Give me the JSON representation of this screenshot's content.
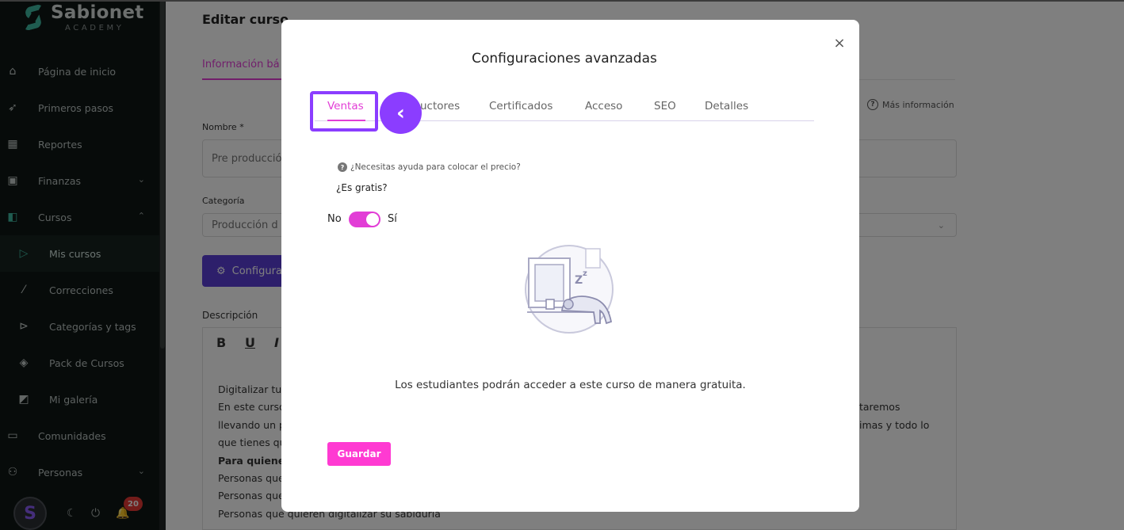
{
  "brand": {
    "name": "Sabionet",
    "sub": "ACADEMY"
  },
  "sidebar": {
    "items": [
      {
        "label": "Página de inicio",
        "icon": "home-icon"
      },
      {
        "label": "Primeros pasos",
        "icon": "rocket-icon"
      },
      {
        "label": "Reportes",
        "icon": "chart-icon"
      },
      {
        "label": "Finanzas",
        "icon": "wallet-icon"
      },
      {
        "label": "Cursos",
        "icon": "courses-icon"
      },
      {
        "label": "Mis cursos",
        "icon": "play-icon"
      },
      {
        "label": "Correcciones",
        "icon": "grade-icon"
      },
      {
        "label": "Categorías y tags",
        "icon": "tag-icon"
      },
      {
        "label": "Pack de Cursos",
        "icon": "layers-icon"
      },
      {
        "label": "Mi galería",
        "icon": "gallery-icon"
      },
      {
        "label": "Comunidades",
        "icon": "chat-icon"
      },
      {
        "label": "Personas",
        "icon": "people-icon"
      }
    ],
    "notifications": "20"
  },
  "page": {
    "title": "Editar curso",
    "tab": "Información bá",
    "more_info": "Más información",
    "name_label": "Nombre *",
    "name_value": "Pre producción",
    "category_label": "Categoría",
    "category_value": "Producción d",
    "config_button": "Configura",
    "description_label": "Descripción",
    "description_lines": [
      "Digitalizar tu",
      "En este curso",
      "llevando un p",
      "que tienes qu",
      "Para quienes",
      "Personas que",
      "Personas que",
      "Personas que quieren digitalizar su sabiduría"
    ],
    "description_right_1": "taremos",
    "description_right_2": "imas y todo lo"
  },
  "modal": {
    "title": "Configuraciones avanzadas",
    "close": "×",
    "tabs": [
      "Ventas",
      "uctores",
      "Certificados",
      "Acceso",
      "SEO",
      "Detalles"
    ],
    "active_tab": "Ventas",
    "help_text": "¿Necesitas ayuda para colocar el precio?",
    "free_question": "¿Es gratis?",
    "toggle_no": "No",
    "toggle_yes": "Sí",
    "free_message": "Los estudiantes podrán acceder a este curso de manera gratuita.",
    "save_button": "Guardar"
  },
  "colors": {
    "accent": "#e23dd6",
    "highlight": "#8b3dff",
    "brand": "#3fb8a0",
    "save": "#ff3ad2"
  }
}
